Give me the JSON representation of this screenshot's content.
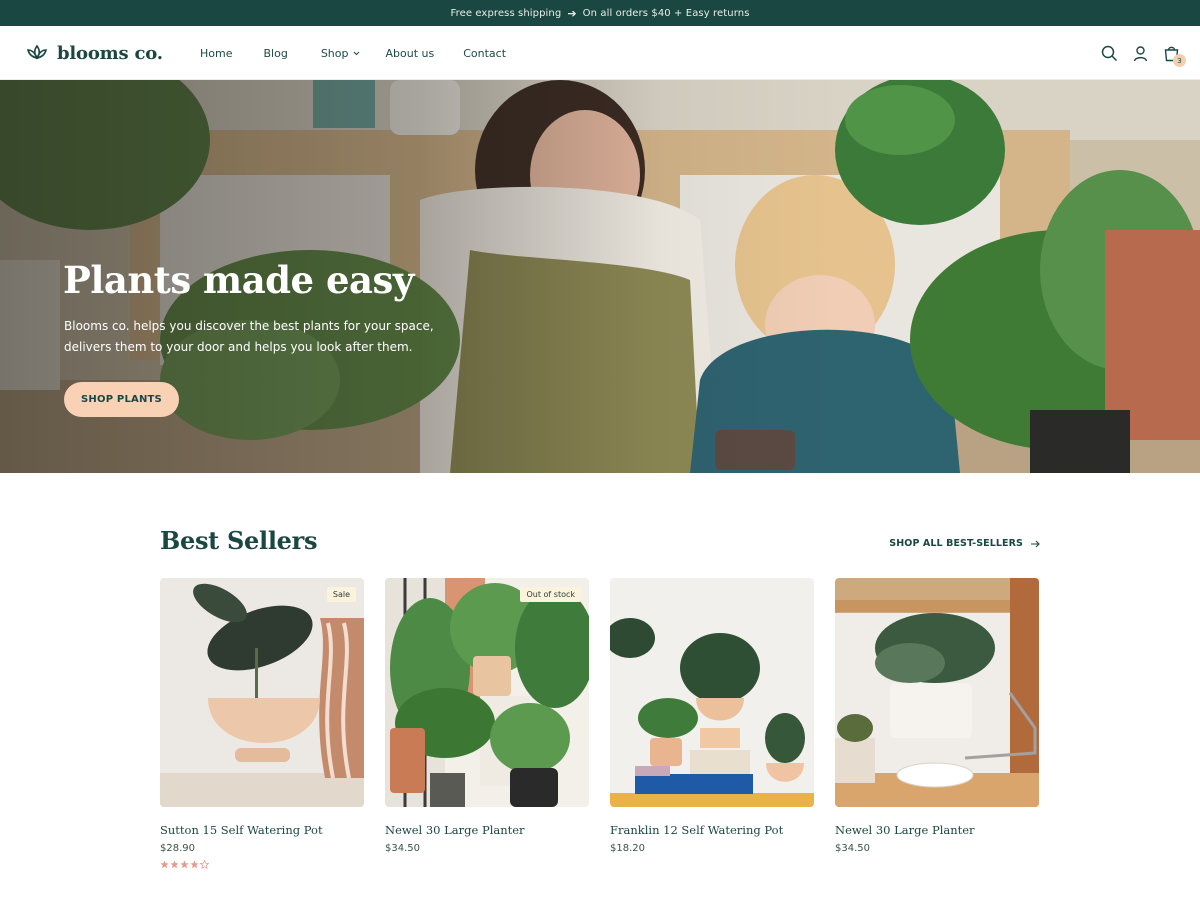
{
  "announcement": {
    "left_text": "Free express shipping",
    "right_text": "On all orders $40 + Easy returns",
    "icon": "arrow-right-icon"
  },
  "header": {
    "logo_text": "blooms co.",
    "nav": [
      {
        "label": "Home"
      },
      {
        "label": "Blog"
      },
      {
        "label": "Shop",
        "has_dropdown": true
      },
      {
        "label": "About us"
      },
      {
        "label": "Contact"
      }
    ],
    "icons": [
      "search-icon",
      "account-icon",
      "cart-icon"
    ],
    "cart_count": "3"
  },
  "hero": {
    "title": "Plants made easy",
    "text": "Blooms co. helps you discover the best plants for your space, delivers them to your door and helps you look after them.",
    "button_label": "SHOP PLANTS"
  },
  "best_sellers": {
    "title": "Best Sellers",
    "shop_all_label": "SHOP ALL BEST-SELLERS",
    "products": [
      {
        "name": "Sutton 15 Self Watering Pot",
        "price": "$28.90",
        "tag": "Sale",
        "rating": 4,
        "rating_max": 5
      },
      {
        "name": "Newel 30 Large Planter",
        "price": "$34.50",
        "tag": "Out of stock"
      },
      {
        "name": "Franklin 12 Self Watering Pot",
        "price": "$18.20",
        "tag": ""
      },
      {
        "name": "Newel 30 Large Planter",
        "price": "$34.50",
        "tag": ""
      }
    ]
  },
  "colors": {
    "brand_dark": "#1b4742",
    "accent_peach": "#f9d2b5",
    "rating_star": "#e89a8e"
  }
}
